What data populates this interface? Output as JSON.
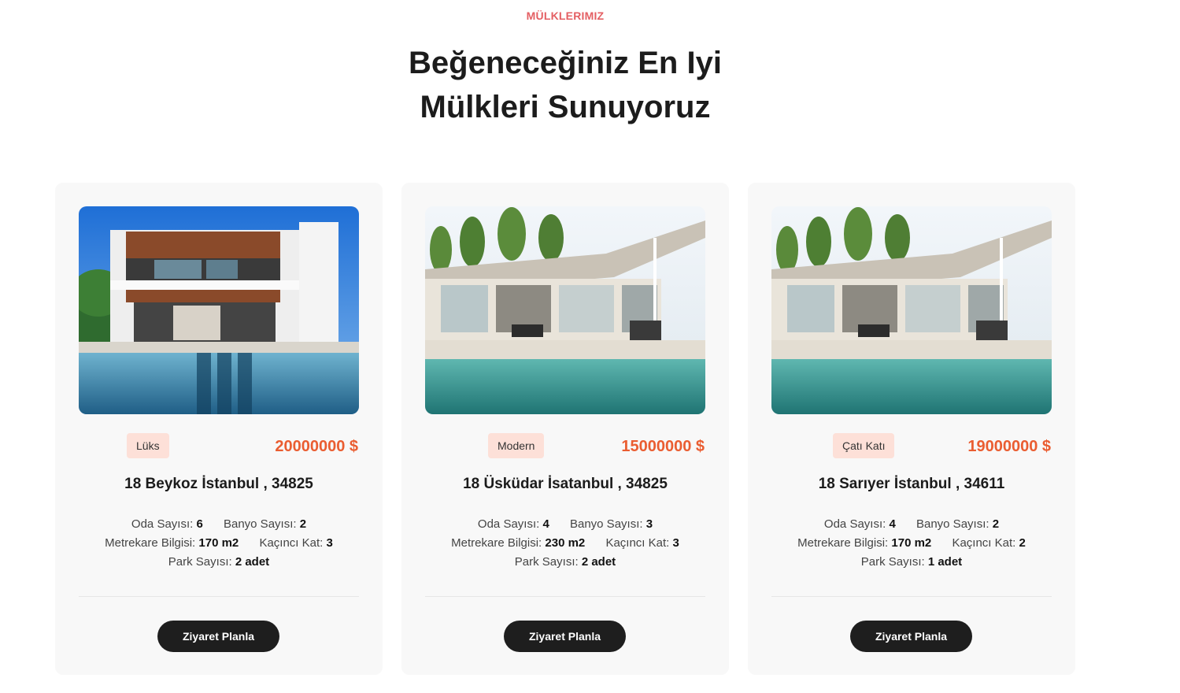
{
  "section": {
    "eyebrow": "MÜLKLERIMIZ",
    "title_line1": "Beğeneceğiniz En Iyi",
    "title_line2": "Mülkleri Sunuyoruz"
  },
  "labels": {
    "rooms": "Oda Sayısı:",
    "baths": "Banyo Sayısı:",
    "area": "Metrekare Bilgisi:",
    "floor": "Kaçıncı Kat:",
    "parking": "Park Sayısı:"
  },
  "cards": [
    {
      "tag": "Lüks",
      "price": "20000000 $",
      "address": "18 Beykoz İstanbul , 34825",
      "rooms": "6",
      "baths": "2",
      "area": "170 m2",
      "floor": "3",
      "parking": "2 adet",
      "button": "Ziyaret Planla",
      "image": "modern-villa-pool-photo"
    },
    {
      "tag": "Modern",
      "price": "15000000 $",
      "address": "18 Üsküdar İsatanbul , 34825",
      "rooms": "4",
      "baths": "3",
      "area": "230 m2",
      "floor": "3",
      "parking": "2 adet",
      "button": "Ziyaret Planla",
      "image": "patio-house-pool-photo"
    },
    {
      "tag": "Çatı Katı",
      "price": "19000000 $",
      "address": "18 Sarıyer İstanbul , 34611",
      "rooms": "4",
      "baths": "2",
      "area": "170 m2",
      "floor": "2",
      "parking": "1 adet",
      "button": "Ziyaret Planla",
      "image": "patio-house-pool-photo"
    }
  ],
  "colors": {
    "accent": "#ea5d31",
    "eyebrow": "#e45f63",
    "tag_bg": "#fde0d8",
    "button_bg": "#1e1e1e",
    "card_bg": "#f8f8f8"
  }
}
